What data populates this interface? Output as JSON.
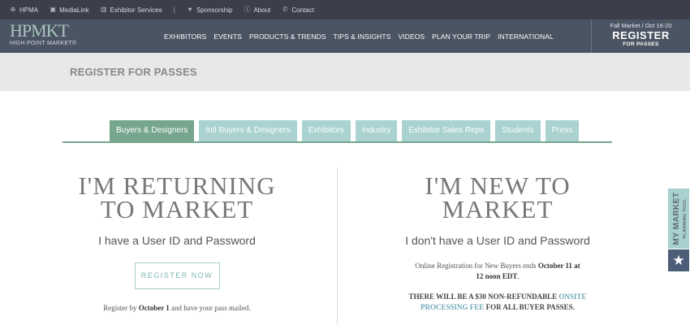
{
  "utility_nav": {
    "items": [
      {
        "icon": "globe-icon",
        "glyph": "⊕",
        "label": "HPMA"
      },
      {
        "icon": "media-icon",
        "glyph": "▣",
        "label": "MediaLink"
      },
      {
        "icon": "building-icon",
        "glyph": "▥",
        "label": "Exhibitor Services"
      }
    ],
    "separator": "|",
    "items_right": [
      {
        "icon": "heart-icon",
        "glyph": "♥",
        "label": "Sponsorship"
      },
      {
        "icon": "info-icon",
        "glyph": "ⓘ",
        "label": "About"
      },
      {
        "icon": "phone-icon",
        "glyph": "✆",
        "label": "Contact"
      }
    ]
  },
  "logo": {
    "main": "HPMKT",
    "sub": "HIGH POINT MARKET®"
  },
  "main_nav": [
    "EXHIBITORS",
    "EVENTS",
    "PRODUCTS & TRENDS",
    "TIPS & INSIGHTS",
    "VIDEOS",
    "PLAN YOUR TRIP",
    "INTERNATIONAL"
  ],
  "register_box": {
    "dates": "Fall Market / Oct 16-20",
    "label": "REGISTER",
    "sublabel": "FOR PASSES"
  },
  "page_title": "REGISTER FOR PASSES",
  "tabs": [
    "Buyers & Designers",
    "Intl Buyers & Designers",
    "Exhibitors",
    "Industry",
    "Exhibitor Sales Reps",
    "Students",
    "Press"
  ],
  "active_tab": "Buyers & Designers",
  "returning": {
    "heading_line1": "I'M RETURNING",
    "heading_line2": "TO MARKET",
    "subheading": "I have a User ID and Password",
    "button": "REGISTER NOW",
    "note_prefix": "Register by ",
    "note_bold": "October 1",
    "note_suffix": " and have your pass mailed."
  },
  "new_user": {
    "heading_line1": "I'M NEW TO",
    "heading_line2": "MARKET",
    "subheading": "I don't have a User ID and Password",
    "online_prefix": "Online Registration for New Buyers ends ",
    "online_bold1": "October 11 at",
    "online_bold2": "12 noon EDT",
    "online_suffix": ".",
    "fee_prefix": "THERE WILL BE A $30 NON-REFUNDABLE ",
    "fee_link1": "ONSITE",
    "fee_link2": "PROCESSING FEE",
    "fee_suffix": " FOR ALL BUYER PASSES."
  },
  "side_tool": {
    "my_market": "MY MARKET",
    "planning": "PLANNING TOOL",
    "star_icon": "star-icon"
  },
  "colors": {
    "topbar": "#3b3f4a",
    "navbar": "#4b5462",
    "tab": "#a9d2d0",
    "tab_active": "#76a68e",
    "accent_link": "#6fa9b9",
    "side_tool": "#a8d0cf",
    "star_box": "#4c5d78"
  }
}
